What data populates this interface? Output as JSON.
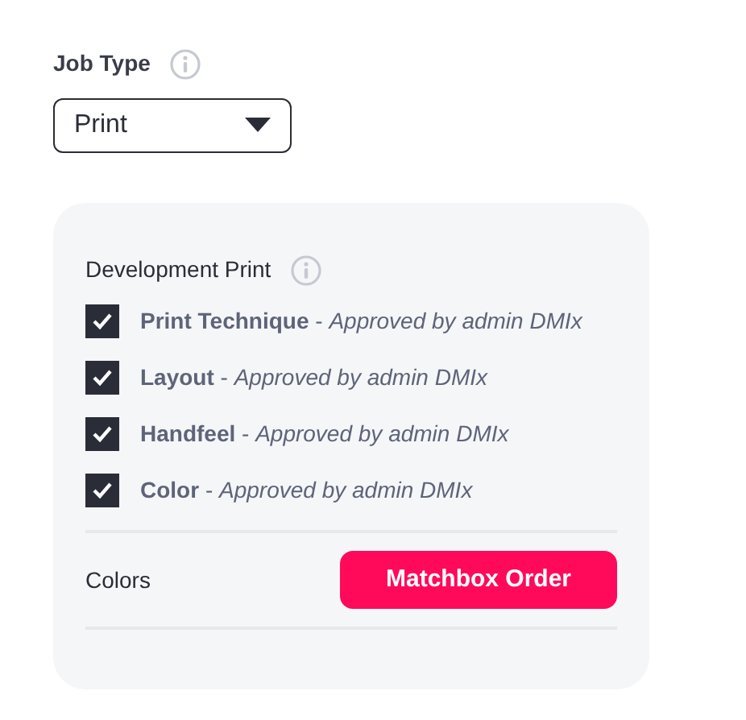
{
  "job_type": {
    "label": "Job Type",
    "value": "Print"
  },
  "development_print": {
    "title": "Development Print",
    "items": [
      {
        "text": "**Print Technique** - *Approved by admin DMIx*",
        "checked": true
      },
      {
        "text": "**Layout** - *Approved by admin DMIx*",
        "checked": true
      },
      {
        "text": "**Handfeel** - *Approved by admin DMIx*",
        "checked": true
      },
      {
        "text": "**Color** - *Approved by admin DMIx*",
        "checked": true
      }
    ],
    "colors": {
      "label": "Colors",
      "button": "Matchbox Order"
    }
  }
}
